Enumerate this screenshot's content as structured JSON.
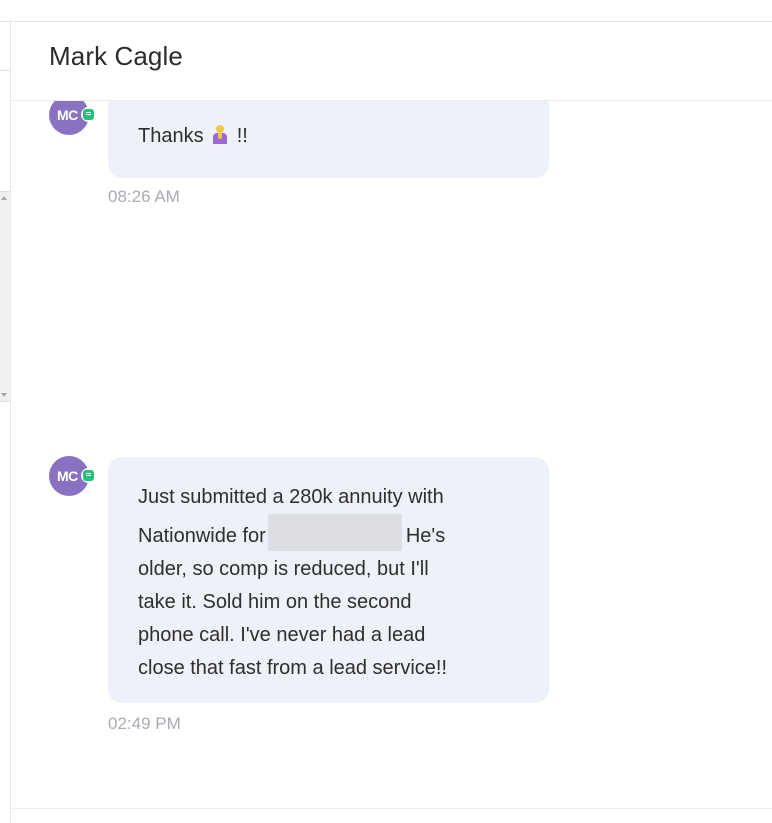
{
  "header": {
    "title": "Mark Cagle"
  },
  "messages": [
    {
      "avatar_initials": "MC",
      "text_before": "Thanks",
      "emoji": "person-bowing-emoji",
      "text_after": "!!",
      "time": "08:26 AM"
    },
    {
      "avatar_initials": "MC",
      "lines": [
        "Just submitted a 280k annuity with",
        "Nationwide for",
        "He's",
        "older, so comp is reduced, but I'll",
        "take it. Sold him on the second",
        "phone call. I've never had a lead",
        "close that fast from a lead service!!"
      ],
      "time": "02:49 PM"
    }
  ],
  "colors": {
    "avatar": "#8a72c2",
    "presence": "#27c07a",
    "bubble": "#eef1f8",
    "timestamp": "#a8acb3"
  }
}
